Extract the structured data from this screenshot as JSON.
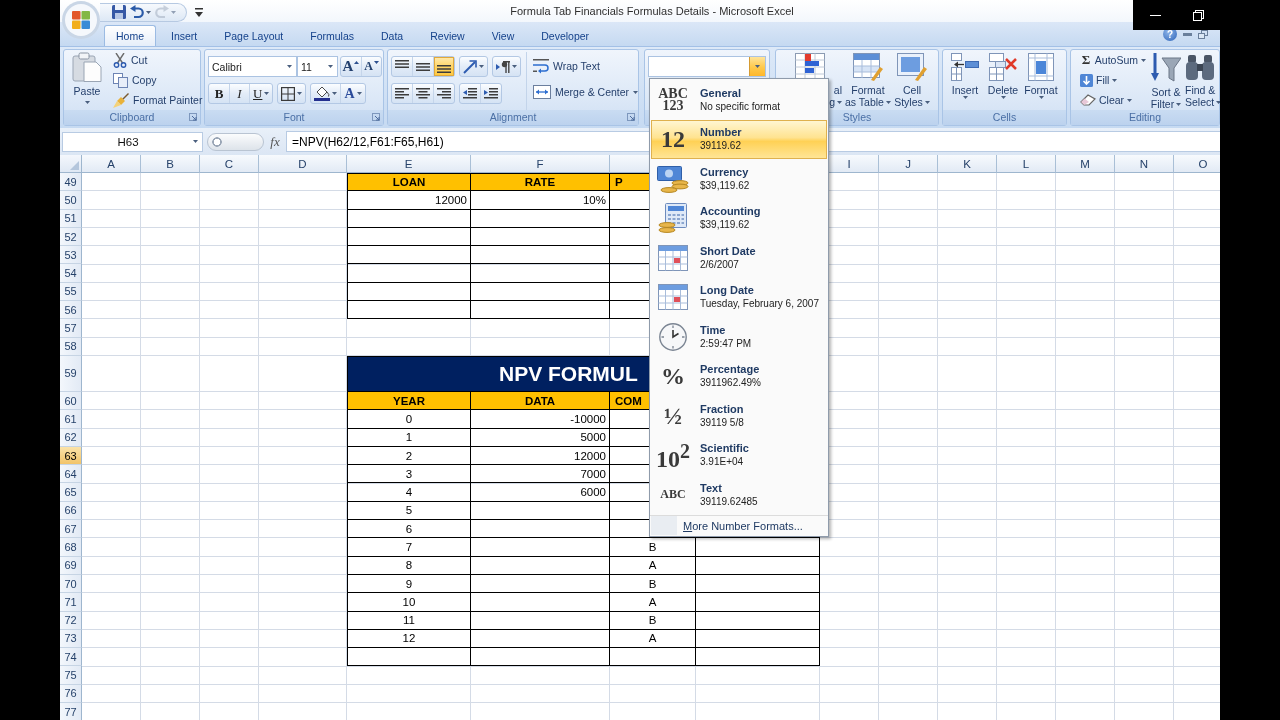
{
  "title_bar": {
    "title": "Formula Tab Financials Formulas Details - Microsoft Excel",
    "quick_access": [
      {
        "kind": "save",
        "disabled": false
      },
      {
        "kind": "undo",
        "disabled": false
      },
      {
        "kind": "redo",
        "disabled": true
      }
    ]
  },
  "tabs": [
    {
      "label": "Home",
      "selected": true
    },
    {
      "label": "Insert",
      "selected": false
    },
    {
      "label": "Page Layout",
      "selected": false
    },
    {
      "label": "Formulas",
      "selected": false
    },
    {
      "label": "Data",
      "selected": false
    },
    {
      "label": "Review",
      "selected": false
    },
    {
      "label": "View",
      "selected": false
    },
    {
      "label": "Developer",
      "selected": false
    }
  ],
  "help": "?",
  "ribbon": {
    "clipboard": {
      "title": "Clipboard",
      "paste": "Paste",
      "actions": [
        {
          "kind": "cut",
          "label": "Cut"
        },
        {
          "kind": "copy",
          "label": "Copy"
        },
        {
          "kind": "painter",
          "label": "Format Painter"
        }
      ]
    },
    "font": {
      "title": "Font",
      "family": "Calibri",
      "size": "11",
      "grow": "A",
      "shrink": "A",
      "styles": [
        {
          "kind": "bold",
          "label": "B"
        },
        {
          "kind": "italic",
          "label": "I"
        },
        {
          "kind": "underline",
          "label": "U"
        }
      ],
      "font_color": "A"
    },
    "alignment": {
      "title": "Alignment",
      "vertical": [
        {
          "kind": "top",
          "selected": false
        },
        {
          "kind": "middle",
          "selected": false
        },
        {
          "kind": "bottom",
          "selected": true
        }
      ],
      "horizontal": [
        {
          "kind": "left",
          "selected": false
        },
        {
          "kind": "center",
          "selected": false
        },
        {
          "kind": "right",
          "selected": false
        }
      ],
      "wrap_text": "Wrap Text",
      "merge": "Merge & Center"
    },
    "number": {
      "expanded": true,
      "options": [
        {
          "kind": "stacked",
          "glyph": "ABC 123",
          "name": "General",
          "sample": "No specific format",
          "selected": false
        },
        {
          "kind": "glyph",
          "glyph": "12",
          "name": "Number",
          "sample": "39119.62",
          "selected": true
        },
        {
          "kind": "currency",
          "name": "Currency",
          "sample": "$39,119.62",
          "selected": false
        },
        {
          "kind": "accounting",
          "name": "Accounting",
          "sample": "$39,119.62",
          "selected": false
        },
        {
          "kind": "calendar",
          "name": "Short Date",
          "sample": "2/6/2007",
          "selected": false
        },
        {
          "kind": "calendar",
          "name": "Long Date",
          "sample": "Tuesday, February 6, 2007",
          "selected": false
        },
        {
          "kind": "clock",
          "name": "Time",
          "sample": "2:59:47 PM",
          "selected": false
        },
        {
          "kind": "glyph",
          "glyph": "%",
          "name": "Percentage",
          "sample": "3911962.49%",
          "selected": false
        },
        {
          "kind": "glyph",
          "glyph": "½",
          "name": "Fraction",
          "sample": "39119 5/8",
          "selected": false
        },
        {
          "kind": "glyph",
          "glyph": "10$^{2}$",
          "name": "Scientific",
          "sample": "3.91E+04",
          "selected": false
        },
        {
          "kind": "word",
          "glyph": "ABC",
          "name": "Text",
          "sample": "39119.62485",
          "selected": false
        }
      ],
      "more": "More Number Formats..."
    },
    "styles": {
      "title": "Styles",
      "buttons": [
        {
          "kind": "conditional",
          "lines": [
            "al",
            "g"
          ]
        },
        {
          "kind": "table",
          "lines": [
            "Format",
            "as Table"
          ]
        },
        {
          "kind": "cell",
          "lines": [
            "Cell",
            "Styles"
          ]
        }
      ]
    },
    "cells": {
      "title": "Cells",
      "buttons": [
        {
          "kind": "insert",
          "label": "Insert"
        },
        {
          "kind": "delete",
          "label": "Delete"
        },
        {
          "kind": "format",
          "label": "Format"
        }
      ]
    },
    "editing": {
      "title": "Editing",
      "actions": [
        {
          "kind": "sum",
          "glyph": "Σ",
          "label": "AutoSum"
        },
        {
          "kind": "fill",
          "label": "Fill"
        },
        {
          "kind": "clear",
          "label": "Clear"
        }
      ],
      "buttons": [
        {
          "kind": "sort",
          "lines": [
            "Sort &",
            "Filter"
          ]
        },
        {
          "kind": "find",
          "lines": [
            "Find &",
            "Select"
          ]
        }
      ]
    }
  },
  "formula_bar": {
    "name_box": "H63",
    "function_label": "fx",
    "formula": "=NPV(H62/12,F61:F65,H61)"
  },
  "sheet": {
    "columns": [
      "A",
      "B",
      "C",
      "D",
      "E",
      "F",
      null,
      null,
      "I",
      "J",
      "K",
      "L",
      "M",
      "N",
      "O"
    ],
    "rows": [
      {
        "label": "49",
        "selected": false
      },
      {
        "label": "50",
        "selected": false
      },
      {
        "label": "51",
        "selected": false
      },
      {
        "label": "52",
        "selected": false
      },
      {
        "label": "53",
        "selected": false
      },
      {
        "label": "54",
        "selected": false
      },
      {
        "label": "55",
        "selected": false
      },
      {
        "label": "56",
        "selected": false
      },
      {
        "label": "57",
        "selected": false
      },
      {
        "label": "58",
        "selected": false
      },
      {
        "label": "59",
        "selected": false
      },
      {
        "label": "60",
        "selected": false
      },
      {
        "label": "61",
        "selected": false
      },
      {
        "label": "62",
        "selected": false
      },
      {
        "label": "63",
        "selected": true
      },
      {
        "label": "64",
        "selected": false
      },
      {
        "label": "65",
        "selected": false
      },
      {
        "label": "66",
        "selected": false
      },
      {
        "label": "67",
        "selected": false
      },
      {
        "label": "68",
        "selected": false
      },
      {
        "label": "69",
        "selected": false
      },
      {
        "label": "70",
        "selected": false
      },
      {
        "label": "71",
        "selected": false
      },
      {
        "label": "72",
        "selected": false
      },
      {
        "label": "73",
        "selected": false
      },
      {
        "label": "74",
        "selected": false
      },
      {
        "label": "75",
        "selected": false
      },
      {
        "label": "76",
        "selected": false
      },
      {
        "label": "77",
        "selected": false
      }
    ],
    "tables": [
      {
        "header": [
          "LOAN",
          "RATE",
          "P"
        ],
        "rows": [
          [
            "12000",
            "10%",
            null
          ],
          [
            null,
            null,
            null
          ],
          [
            null,
            null,
            null
          ],
          [
            null,
            null,
            null
          ],
          [
            null,
            null,
            null
          ],
          [
            null,
            null,
            null
          ],
          [
            null,
            null,
            null
          ]
        ]
      },
      {
        "title": "NPV FORMUL",
        "header": [
          "YEAR",
          "DATA",
          "COM"
        ],
        "rows": [
          [
            "0",
            "-10000",
            null,
            null
          ],
          [
            "1",
            "5000",
            null,
            null
          ],
          [
            "2",
            "12000",
            null,
            null
          ],
          [
            "3",
            "7000",
            null,
            null
          ],
          [
            "4",
            "6000",
            null,
            null
          ],
          [
            "5",
            null,
            null,
            null
          ],
          [
            "6",
            null,
            null,
            null
          ],
          [
            "7",
            null,
            "B",
            null
          ],
          [
            "8",
            null,
            "A",
            null
          ],
          [
            "9",
            null,
            "B",
            null
          ],
          [
            "10",
            null,
            "A",
            null
          ],
          [
            "11",
            null,
            "B",
            null
          ],
          [
            "12",
            null,
            "A",
            null
          ],
          [
            null,
            null,
            null,
            null
          ]
        ]
      }
    ]
  }
}
